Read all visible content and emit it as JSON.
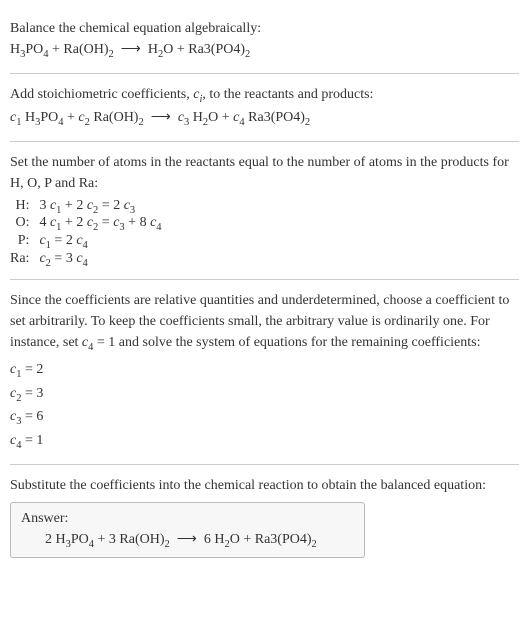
{
  "chart_data": {
    "type": "table",
    "title": "Balance chemical equation algebraically",
    "reaction_unbalanced": "H3PO4 + Ra(OH)2 -> H2O + Ra3(PO4)2",
    "reaction_with_coeffs": "c1 H3PO4 + c2 Ra(OH)2 -> c3 H2O + c4 Ra3(PO4)2",
    "atom_balance_equations": [
      {
        "element": "H",
        "equation": "3 c1 + 2 c2 = 2 c3"
      },
      {
        "element": "O",
        "equation": "4 c1 + 2 c2 = c3 + 8 c4"
      },
      {
        "element": "P",
        "equation": "c1 = 2 c4"
      },
      {
        "element": "Ra",
        "equation": "c2 = 3 c4"
      }
    ],
    "arbitrary_set": "c4 = 1",
    "solution": {
      "c1": 2,
      "c2": 3,
      "c3": 6,
      "c4": 1
    },
    "balanced_equation": "2 H3PO4 + 3 Ra(OH)2 -> 6 H2O + Ra3(PO4)2"
  },
  "s1": {
    "title": "Balance the chemical equation algebraically:"
  },
  "s2": {
    "title_a": "Add stoichiometric coefficients, ",
    "title_b": ", to the reactants and products:"
  },
  "s3": {
    "title": "Set the number of atoms in the reactants equal to the number of atoms in the products for H, O, P and Ra:",
    "rows": [
      {
        "label": "H:"
      },
      {
        "label": "O:"
      },
      {
        "label": "P:"
      },
      {
        "label": "Ra:"
      }
    ]
  },
  "s4": {
    "title_a": "Since the coefficients are relative quantities and underdetermined, choose a coefficient to set arbitrarily. To keep the coefficients small, the arbitrary value is ordinarily one. For instance, set ",
    "title_b": " and solve the system of equations for the remaining coefficients:"
  },
  "s5": {
    "title": "Substitute the coefficients into the chemical reaction to obtain the balanced equation:"
  },
  "answer_label": "Answer:"
}
